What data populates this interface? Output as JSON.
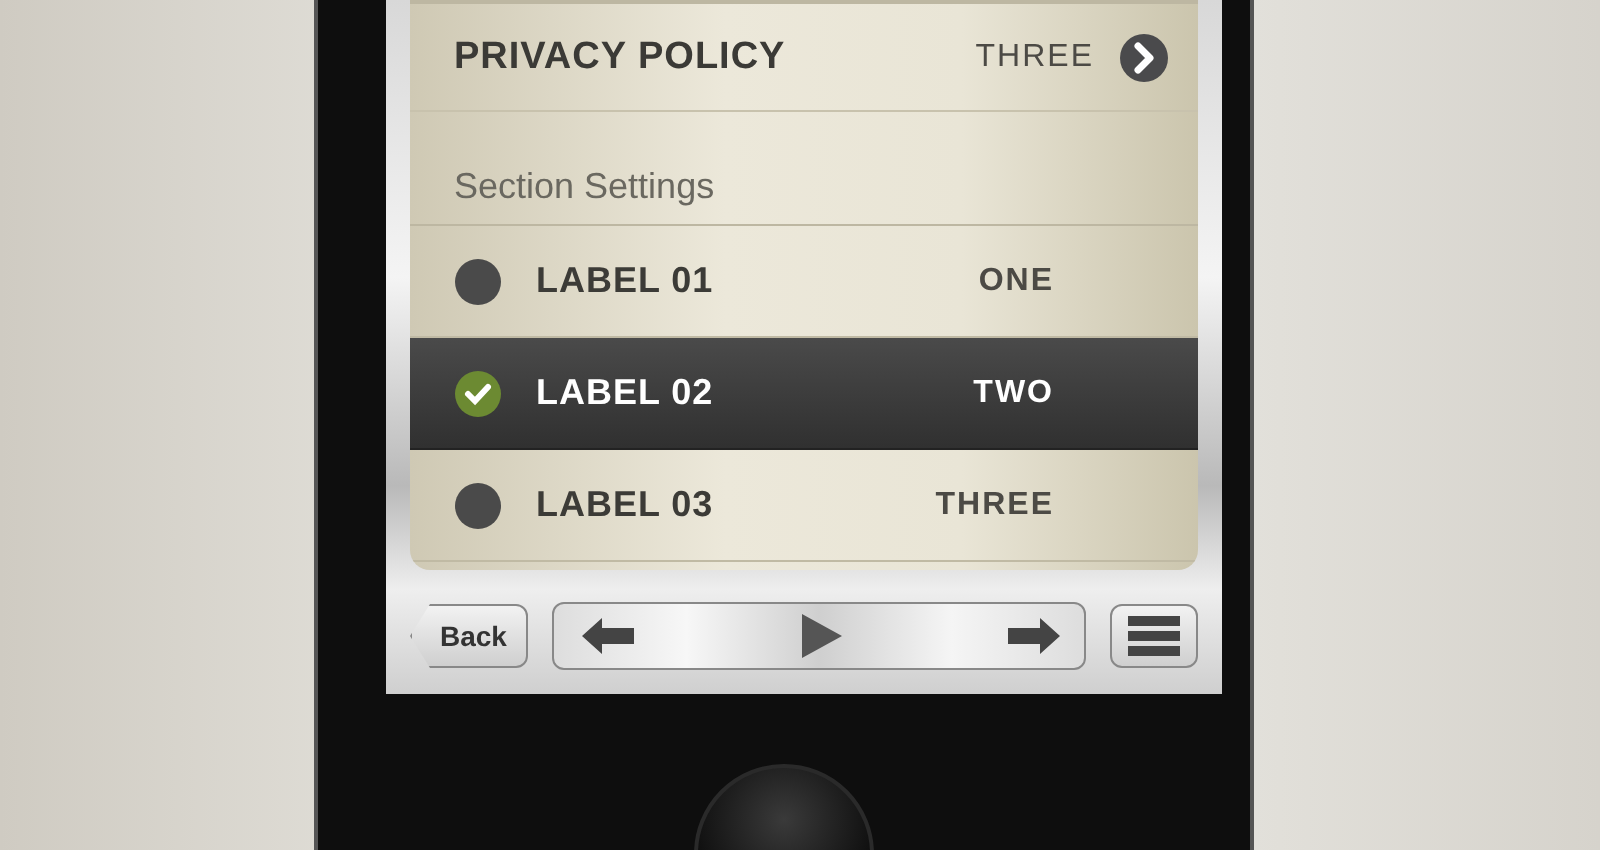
{
  "privacy_row": {
    "label": "PRIVACY POLICY",
    "value": "THREE"
  },
  "section_header": "Section Settings",
  "options": [
    {
      "label": "LABEL 01",
      "value": "ONE",
      "selected": false
    },
    {
      "label": "LABEL 02",
      "value": "TWO",
      "selected": true
    },
    {
      "label": "LABEL 03",
      "value": "THREE",
      "selected": false
    }
  ],
  "toolbar": {
    "back_button": "Back"
  }
}
